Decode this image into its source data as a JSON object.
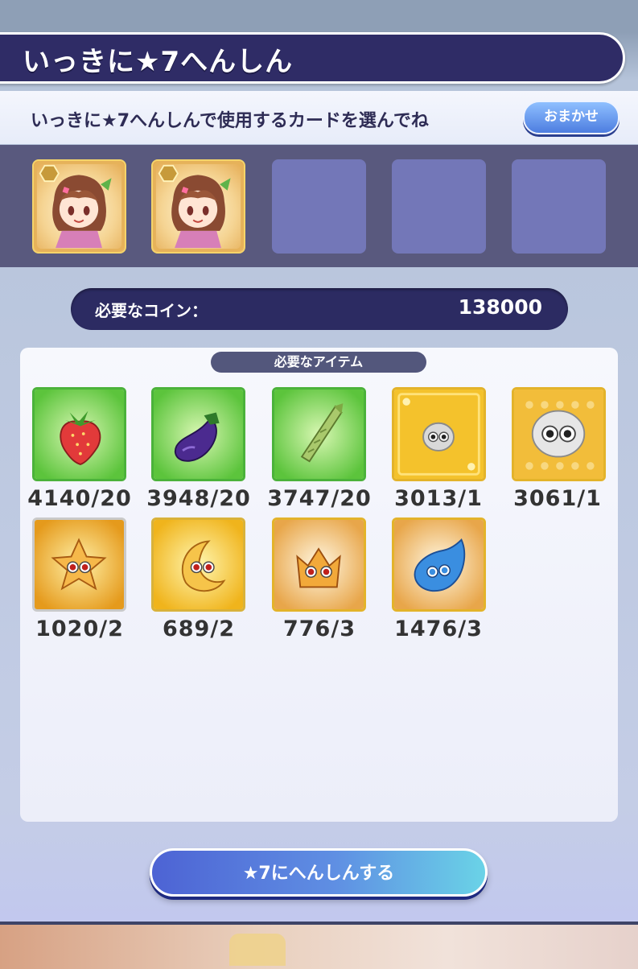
{
  "header": {
    "title": "いっきに★7へんしん"
  },
  "instruction": {
    "text": "いっきに★7へんしんで使用するカードを選んでね",
    "omakase_label": "おまかせ"
  },
  "card_slots": [
    {
      "filled": true,
      "icon": "girl-card-portrait"
    },
    {
      "filled": true,
      "icon": "girl-card-portrait"
    },
    {
      "filled": false
    },
    {
      "filled": false
    },
    {
      "filled": false
    }
  ],
  "coins": {
    "label": "必要なコイン：",
    "value": "138000"
  },
  "items": {
    "header": "必要なアイテム",
    "list": [
      {
        "icon": "strawberry-icon",
        "count": "4140/20"
      },
      {
        "icon": "eggplant-icon",
        "count": "3948/20"
      },
      {
        "icon": "asparagus-icon",
        "count": "3747/20"
      },
      {
        "icon": "small-white-puyo-icon",
        "count": "3013/1"
      },
      {
        "icon": "large-white-puyo-icon",
        "count": "3061/1"
      },
      {
        "icon": "star-puyo-icon",
        "count": "1020/2"
      },
      {
        "icon": "moon-puyo-icon",
        "count": "689/2"
      },
      {
        "icon": "crown-puyo-icon",
        "count": "776/3"
      },
      {
        "icon": "blue-puyo-icon",
        "count": "1476/3"
      }
    ]
  },
  "action": {
    "label": "★7にへんしんする"
  },
  "colors": {
    "header_navy": "#2f2c66",
    "empty_slot": "#7377b8",
    "coin_bar": "#2c2b62",
    "accent_blue": "#4d7de0"
  }
}
